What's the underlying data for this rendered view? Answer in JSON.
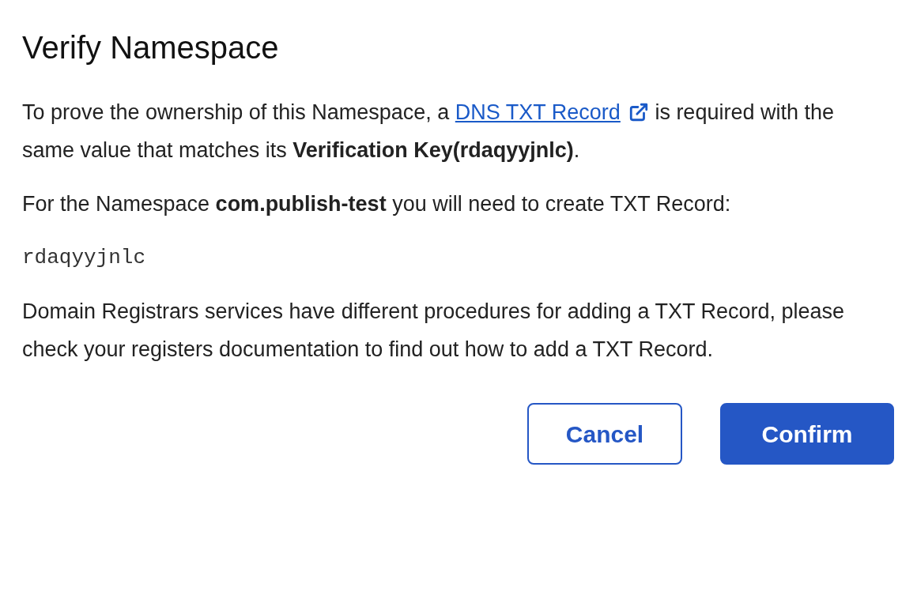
{
  "dialog": {
    "title": "Verify Namespace",
    "intro": {
      "before": "To prove the ownership of this Namespace, a ",
      "link": "DNS TXT Record",
      "after": " is required with the same value that matches its **Verification Key(rdaqyyjnlc)**."
    },
    "instruction": "For the Namespace **com.publish-test** you will need to create TXT Record:",
    "record_value": "rdaqyyjnlc",
    "note": "Domain Registrars services have different procedures for adding a TXT Record, please check your registers documentation to find out how to add a TXT Record.",
    "buttons": [
      {
        "kind": "secondary",
        "label": "Cancel"
      },
      {
        "kind": "primary",
        "label": "Confirm"
      }
    ]
  }
}
